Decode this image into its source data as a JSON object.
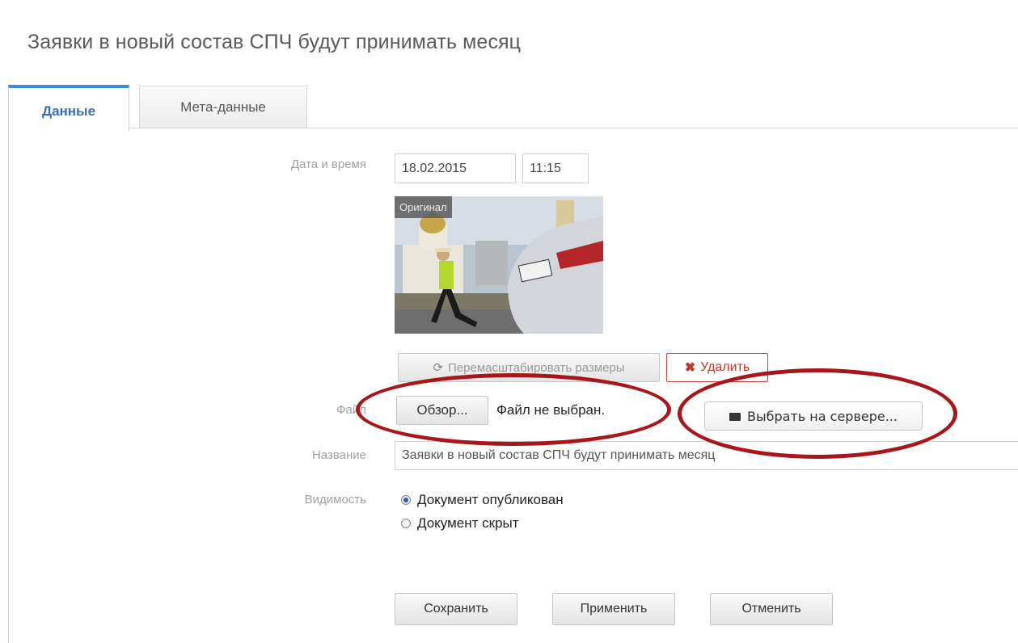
{
  "page": {
    "title": "Заявки в новый состав СПЧ будут принимать месяц"
  },
  "tabs": [
    {
      "label": "Данные",
      "active": true
    },
    {
      "label": "Мета-данные",
      "active": false
    }
  ],
  "form": {
    "date_time": {
      "label": "Дата и время",
      "date_value": "18.02.2015",
      "time_value": "11:15"
    },
    "image": {
      "badge": "Оригинал"
    },
    "image_actions": {
      "resize_label": "Перемасштабировать размеры",
      "delete_label": "Удалить"
    },
    "file": {
      "label": "Файл",
      "browse_label": "Обзор...",
      "status": "Файл не выбран.",
      "server_label": "Выбрать на сервере..."
    },
    "name": {
      "label": "Название",
      "value": "Заявки в новый состав СПЧ будут принимать месяц"
    },
    "visibility": {
      "label": "Видимость",
      "options": [
        {
          "label": "Документ опубликован",
          "checked": true
        },
        {
          "label": "Документ скрыт",
          "checked": false
        }
      ]
    },
    "actions": {
      "save_label": "Сохранить",
      "apply_label": "Применить",
      "cancel_label": "Отменить"
    }
  },
  "colors": {
    "tab_accent": "#3a8fd6",
    "annotation_ellipse": "#a8161a",
    "delete_red": "#c0392b"
  }
}
